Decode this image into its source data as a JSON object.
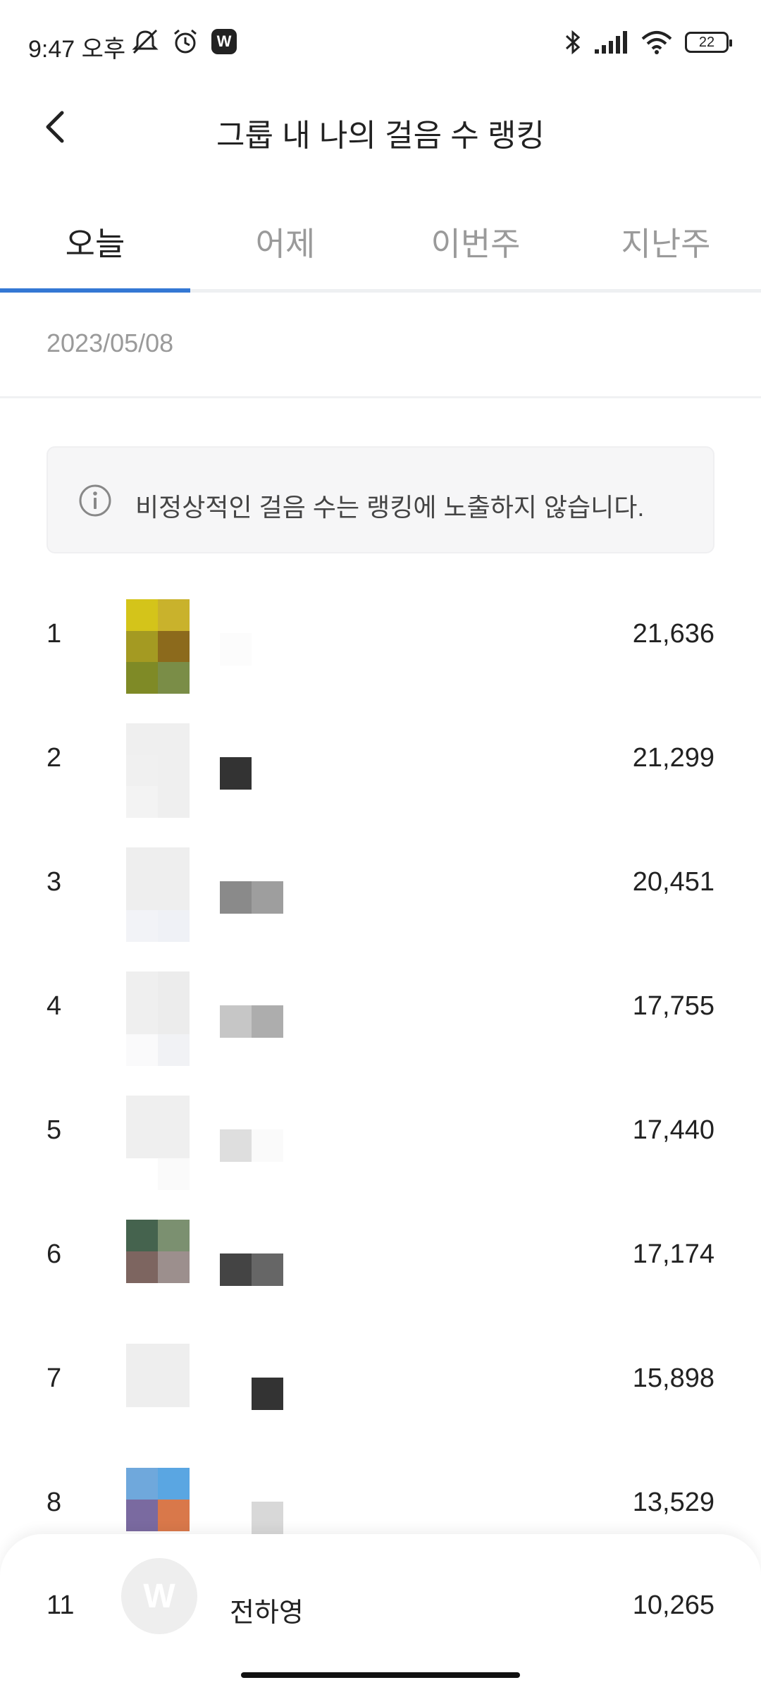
{
  "status_bar": {
    "time": "9:47 오후",
    "app_badge": "W",
    "battery": "22"
  },
  "header": {
    "title": "그룹 내 나의 걸음 수 랭킹"
  },
  "tabs": [
    {
      "label": "오늘",
      "active": true
    },
    {
      "label": "어제",
      "active": false
    },
    {
      "label": "이번주",
      "active": false
    },
    {
      "label": "지난주",
      "active": false
    }
  ],
  "date": "2023/05/08",
  "notice": {
    "text": "비정상적인 걸음 수는 랭킹에 노출하지 않습니다."
  },
  "ranking": [
    {
      "rank": "1",
      "steps": "21,636"
    },
    {
      "rank": "2",
      "steps": "21,299"
    },
    {
      "rank": "3",
      "steps": "20,451"
    },
    {
      "rank": "4",
      "steps": "17,755"
    },
    {
      "rank": "5",
      "steps": "17,440"
    },
    {
      "rank": "6",
      "steps": "17,174"
    },
    {
      "rank": "7",
      "steps": "15,898"
    },
    {
      "rank": "8",
      "steps": "13,529"
    }
  ],
  "my_rank": {
    "rank": "11",
    "avatar_letter": "W",
    "name": "전하영",
    "steps": "10,265"
  },
  "colors": {
    "accent": "#3478d4",
    "inactive_tab": "#9a9a9a"
  }
}
